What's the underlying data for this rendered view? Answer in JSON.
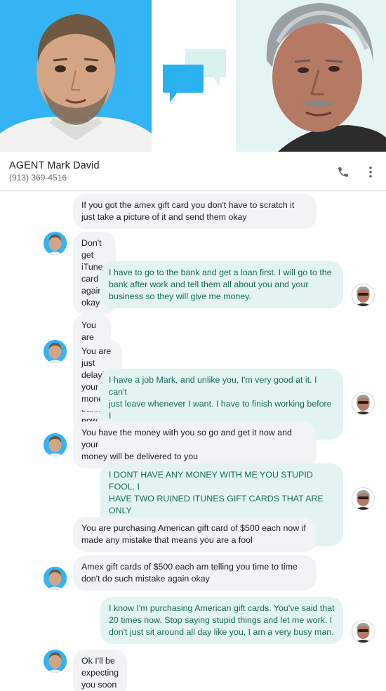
{
  "contact": {
    "name": "AGENT Mark David",
    "phone": "(913) 369-4516"
  },
  "icons": {
    "call": "phone-icon",
    "more": "more-vert-icon",
    "chat": "chat-bubbles-icon"
  },
  "colors": {
    "hero_left": "#34b3f5",
    "hero_right": "#e3f4f3",
    "incoming_bubble": "#f1f3f4",
    "outgoing_bubble": "#e2f3f1",
    "outgoing_text": "#1a6b5b"
  },
  "messages": [
    {
      "from": "agent",
      "text": "If you got the amex gift card you don't have to scratch it\njust take a picture of it and send them okay"
    },
    {
      "from": "agent",
      "text": "Don't get iTunes card again okay"
    },
    {
      "from": "me",
      "text": "I have to go to the bank and get a loan first. I will go to the\nbank after work and tell them all about you and your\nbusiness so they will give me money."
    },
    {
      "from": "agent",
      "text": "You are not even going to the bank now"
    },
    {
      "from": "agent",
      "text": "You are just delaying your money"
    },
    {
      "from": "me",
      "text": "I have a job Mark, and unlike you, I'm very good at it. I can't\njust leave whenever I want. I have to finish working before I\ncan go to the bank."
    },
    {
      "from": "agent",
      "text": "You have the money with you so go and get it now and your\nmoney will be delivered to you"
    },
    {
      "from": "me",
      "text": "I DONT HAVE ANY MONEY WITH ME YOU STUPID FOOL. I\nHAVE TWO RUINED ITUNES GIFT CARDS THAT ARE ONLY\nGOOD FOR ONE DIRECTION SONGS ON APPLE MUSIC."
    },
    {
      "from": "agent",
      "text": "You are  purchasing American gift card of $500 each now if\nmade any mistake that means you are a fool"
    },
    {
      "from": "agent",
      "text": "Amex gift cards of $500 each am telling you time to time\ndon't do such mistake again okay"
    },
    {
      "from": "me",
      "text": "I know I'm purchasing American gift cards. You've said that\n20 times now. Stop saying stupid things and let me work. I\ndon't just sit around all day like you, I am a very busy man."
    },
    {
      "from": "agent",
      "text": "Ok I'll be expecting you soon"
    }
  ]
}
